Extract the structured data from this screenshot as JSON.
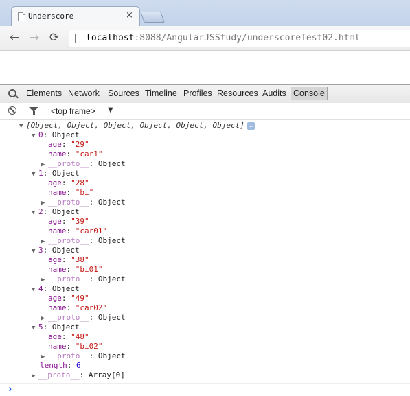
{
  "tab": {
    "title": "Underscore",
    "close": "×"
  },
  "toolbar": {
    "back": "←",
    "forward": "→",
    "reload": "⟳",
    "url_host": "localhost",
    "url_rest": ":8088/AngularJSStudy/underscoreTest02.html"
  },
  "devtools": {
    "tabs": [
      "Elements",
      "Network",
      "Sources",
      "Timeline",
      "Profiles",
      "Resources",
      "Audits",
      "Console"
    ],
    "active_tab": "Console",
    "frame": "<top frame>",
    "frame_arrow": "▼"
  },
  "console": {
    "summary": "[Object, Object, Object, Object, Object, Object]",
    "items": [
      {
        "index": "0",
        "type": "Object",
        "age": "\"29\"",
        "name": "\"car1\""
      },
      {
        "index": "1",
        "type": "Object",
        "age": "\"28\"",
        "name": "\"bi\""
      },
      {
        "index": "2",
        "type": "Object",
        "age": "\"39\"",
        "name": "\"car01\""
      },
      {
        "index": "3",
        "type": "Object",
        "age": "\"38\"",
        "name": "\"bi01\""
      },
      {
        "index": "4",
        "type": "Object",
        "age": "\"49\"",
        "name": "\"car02\""
      },
      {
        "index": "5",
        "type": "Object",
        "age": "\"48\"",
        "name": "\"bi02\""
      }
    ],
    "proto_label": "__proto__",
    "proto_value": "Object",
    "length_label": "length",
    "length_value": "6",
    "array_proto_value": "Array[0]",
    "prompt": "›"
  },
  "colors": {
    "key": "#881391",
    "string": "#c41a16",
    "number": "#1c00cf",
    "prompt": "#2b6cf0"
  }
}
